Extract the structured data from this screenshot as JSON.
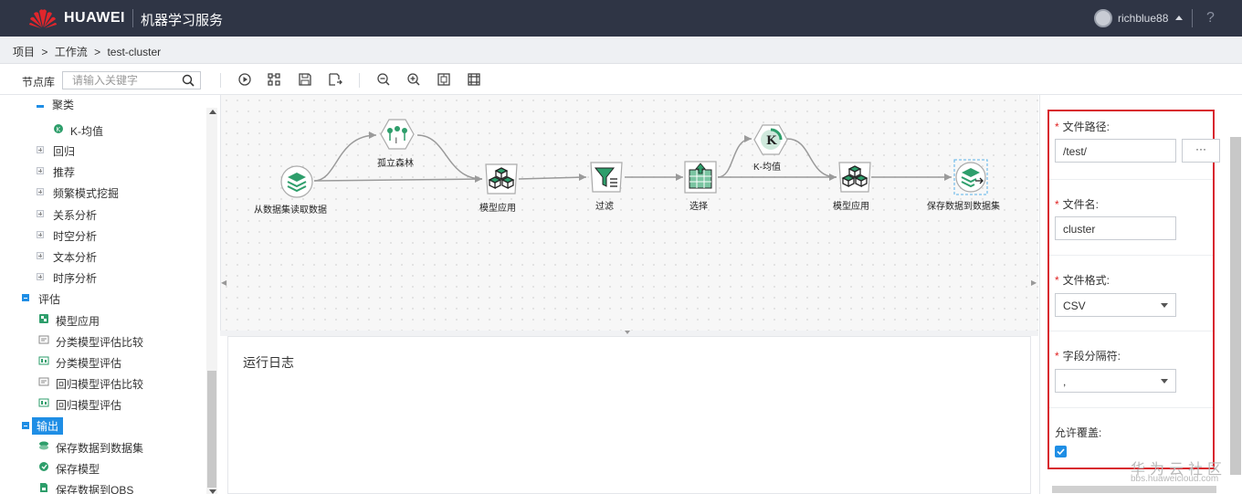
{
  "header": {
    "brand": "HUAWEI",
    "service": "机器学习服务",
    "user": "richblue88",
    "help": "?"
  },
  "breadcrumb": [
    "项目",
    "工作流",
    "test-cluster"
  ],
  "breadcrumb_sep": ">",
  "toolbar": {
    "library_label": "节点库",
    "search_placeholder": "请输入关键字",
    "icons": [
      "run-icon",
      "layout-icon",
      "save-icon",
      "save-as-icon",
      "zoom-out-icon",
      "zoom-in-icon",
      "fit-icon",
      "grid-icon"
    ]
  },
  "tree": [
    {
      "label": "聚类",
      "level": 1,
      "state": "expanded"
    },
    {
      "label": "K-均值",
      "level": 2,
      "icon": "kmeans-icon"
    },
    {
      "label": "回归",
      "level": 1,
      "state": "collapsed"
    },
    {
      "label": "推荐",
      "level": 1,
      "state": "collapsed"
    },
    {
      "label": "频繁模式挖掘",
      "level": 1,
      "state": "collapsed"
    },
    {
      "label": "关系分析",
      "level": 1,
      "state": "collapsed"
    },
    {
      "label": "时空分析",
      "level": 1,
      "state": "collapsed"
    },
    {
      "label": "文本分析",
      "level": 1,
      "state": "collapsed"
    },
    {
      "label": "时序分析",
      "level": 1,
      "state": "collapsed"
    },
    {
      "label": "评估",
      "level": 0,
      "state": "expanded"
    },
    {
      "label": "模型应用",
      "level": 1,
      "icon": "model-apply-icon"
    },
    {
      "label": "分类模型评估比较",
      "level": 1,
      "icon": "compare-icon"
    },
    {
      "label": "分类模型评估",
      "level": 1,
      "icon": "evaluate-icon"
    },
    {
      "label": "回归模型评估比较",
      "level": 1,
      "icon": "compare-icon"
    },
    {
      "label": "回归模型评估",
      "level": 1,
      "icon": "evaluate-icon"
    },
    {
      "label": "输出",
      "level": 0,
      "state": "expanded",
      "selected": true
    },
    {
      "label": "保存数据到数据集",
      "level": 1,
      "icon": "save-dataset-icon"
    },
    {
      "label": "保存模型",
      "level": 1,
      "icon": "save-model-icon"
    },
    {
      "label": "保存数据到OBS",
      "level": 1,
      "icon": "save-obs-icon"
    }
  ],
  "workflow": {
    "nodes": [
      {
        "id": "read",
        "label": "从数据集读取数据",
        "icon": "dataset-read-icon"
      },
      {
        "id": "iforest",
        "label": "孤立森林",
        "icon": "isolation-forest-icon"
      },
      {
        "id": "apply1",
        "label": "模型应用",
        "icon": "model-apply-icon"
      },
      {
        "id": "filter",
        "label": "过滤",
        "icon": "filter-icon"
      },
      {
        "id": "select",
        "label": "选择",
        "icon": "select-icon"
      },
      {
        "id": "kmeans",
        "label": "K-均值",
        "icon": "kmeans-icon"
      },
      {
        "id": "apply2",
        "label": "模型应用",
        "icon": "model-apply-icon"
      },
      {
        "id": "save",
        "label": "保存数据到数据集",
        "icon": "save-dataset-icon"
      }
    ]
  },
  "log": {
    "title": "运行日志"
  },
  "properties": {
    "file_path": {
      "label": "文件路径:",
      "value": "/test/",
      "browse": "···"
    },
    "file_name": {
      "label": "文件名:",
      "value": "cluster"
    },
    "file_format": {
      "label": "文件格式:",
      "value": "CSV"
    },
    "delimiter": {
      "label": "字段分隔符:",
      "value": ","
    },
    "overwrite": {
      "label": "允许覆盖:",
      "checked": true
    }
  },
  "watermark": {
    "title": "华为云社区",
    "url": "bbs.huaweicloud.com"
  },
  "colors": {
    "accent": "#1f8ee5",
    "topbar": "#2f3545",
    "highlight_box": "#d8262e",
    "node_green": "#2e9e6b"
  }
}
